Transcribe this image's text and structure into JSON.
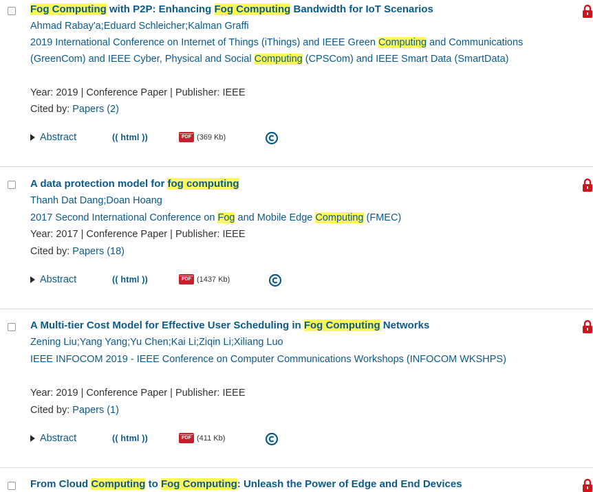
{
  "results": [
    {
      "title_parts": [
        {
          "text": "Fog Computing",
          "hl": true
        },
        {
          "text": " with P2P: Enhancing ",
          "hl": false
        },
        {
          "text": "Fog Computing",
          "hl": true
        },
        {
          "text": " Bandwidth for IoT Scenarios",
          "hl": false
        }
      ],
      "authors": "Ahmad Rabay'a;Eduard Schleicher;Kalman Graffi",
      "venue_parts": [
        {
          "text": "2019 International Conference on Internet of Things (iThings) and IEEE Green ",
          "hl": false
        },
        {
          "text": "Computing",
          "hl": true
        },
        {
          "text": " and Communications (GreenCom) and IEEE Cyber, Physical and Social ",
          "hl": false
        },
        {
          "text": "Computing",
          "hl": true
        },
        {
          "text": " (CPSCom) and IEEE Smart Data (SmartData)",
          "hl": false
        }
      ],
      "meta": "Year: 2019 | Conference Paper | Publisher: IEEE",
      "cited_label": "Cited by: ",
      "cited_link": "Papers (2)",
      "abstract_label": "Abstract",
      "html_label": "(( html ))",
      "pdf_size": "(369 Kb)",
      "pdf_icon_text": "PDF"
    },
    {
      "title_parts": [
        {
          "text": "A data protection model for ",
          "hl": false
        },
        {
          "text": "fog computing",
          "hl": true
        }
      ],
      "authors": "Thanh Dat Dang;Doan Hoang",
      "venue_parts": [
        {
          "text": "2017 Second International Conference on ",
          "hl": false
        },
        {
          "text": "Fog",
          "hl": true
        },
        {
          "text": " and Mobile Edge ",
          "hl": false
        },
        {
          "text": "Computing",
          "hl": true
        },
        {
          "text": " (FMEC)",
          "hl": false
        }
      ],
      "meta": "Year: 2017 | Conference Paper | Publisher: IEEE",
      "cited_label": "Cited by: ",
      "cited_link": "Papers (18)",
      "abstract_label": "Abstract",
      "html_label": "(( html ))",
      "pdf_size": "(1437 Kb)",
      "pdf_icon_text": "PDF"
    },
    {
      "title_parts": [
        {
          "text": "A Multi-tier Cost Model for Effective User Scheduling in ",
          "hl": false
        },
        {
          "text": "Fog Computing",
          "hl": true
        },
        {
          "text": " Networks",
          "hl": false
        }
      ],
      "authors": "Zening Liu;Yang Yang;Yu Chen;Kai Li;Ziqin Li;Xiliang Luo",
      "venue_parts": [
        {
          "text": "IEEE INFOCOM 2019 - IEEE Conference on Computer Communications Workshops (INFOCOM WKSHPS)",
          "hl": false
        }
      ],
      "meta": "Year: 2019 | Conference Paper | Publisher: IEEE",
      "cited_label": "Cited by: ",
      "cited_link": "Papers (1)",
      "abstract_label": "Abstract",
      "html_label": "(( html ))",
      "pdf_size": "(411 Kb)",
      "pdf_icon_text": "PDF"
    },
    {
      "title_parts": [
        {
          "text": "From Cloud ",
          "hl": false
        },
        {
          "text": "Computing",
          "hl": true
        },
        {
          "text": " to ",
          "hl": false
        },
        {
          "text": "Fog Computing",
          "hl": true
        },
        {
          "text": ": Unleash the Power of Edge and End Devices",
          "hl": false
        }
      ]
    }
  ],
  "colors": {
    "link": "#0b5a8c",
    "highlight": "#fcf85c",
    "lock": "#d0141b",
    "pdf": "#c8202a",
    "text": "#333333"
  },
  "icons": {
    "lock": "lock-icon",
    "copyright": "copyright-icon",
    "pdf": "pdf-icon",
    "abstract_toggle": "triangle-right-icon"
  }
}
